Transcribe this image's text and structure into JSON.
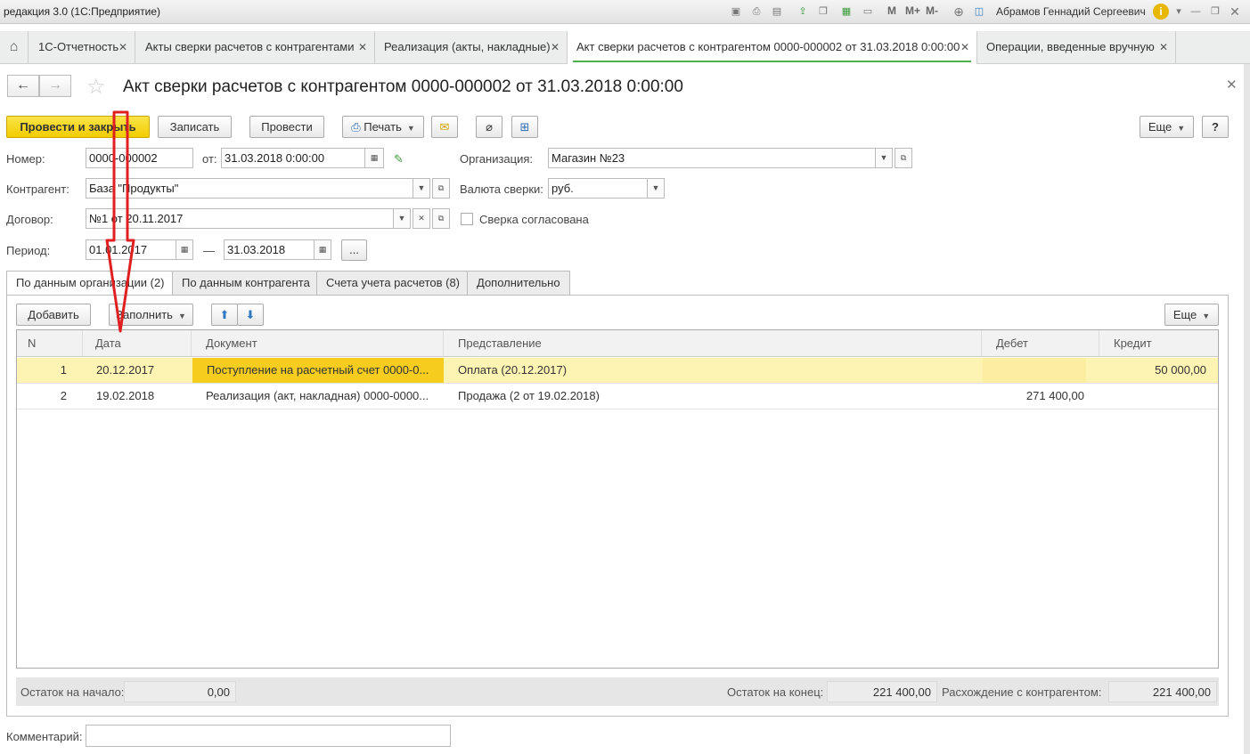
{
  "window": {
    "title": "редакция 3.0  (1С:Предприятие)",
    "user": "Абрамов Геннадий Сергеевич",
    "m_labels": [
      "M",
      "M+",
      "M-"
    ]
  },
  "open_tabs": [
    {
      "label": "1С-Отчетность"
    },
    {
      "label": "Акты сверки расчетов с контрагентами"
    },
    {
      "label": "Реализация (акты, накладные)"
    },
    {
      "label": "Акт сверки расчетов с контрагентом 0000-000002 от 31.03.2018 0:00:00"
    },
    {
      "label": "Операции, введенные вручную"
    }
  ],
  "form": {
    "title": "Акт сверки расчетов с контрагентом 0000-000002 от 31.03.2018 0:00:00",
    "toolbar": {
      "post_close": "Провести и закрыть",
      "save": "Записать",
      "post": "Провести",
      "print": "Печать",
      "more": "Еще",
      "help": "?"
    },
    "fields": {
      "number_label": "Номер:",
      "number": "0000-000002",
      "date_label": "от:",
      "date": "31.03.2018  0:00:00",
      "org_label": "Организация:",
      "org": "Магазин №23",
      "counterparty_label": "Контрагент:",
      "counterparty": "База \"Продукты\"",
      "currency_label": "Валюта сверки:",
      "currency": "руб.",
      "contract_label": "Договор:",
      "contract": "№1 от 20.11.2017",
      "agreed_label": "Сверка согласована",
      "period_label": "Период:",
      "period_from": "01.01.2017",
      "period_dash": "—",
      "period_to": "31.03.2018",
      "period_more": "..."
    },
    "inner_tabs": [
      {
        "label": "По данным организации (2)"
      },
      {
        "label": "По данным контрагента"
      },
      {
        "label": "Счета учета расчетов (8)"
      },
      {
        "label": "Дополнительно"
      }
    ],
    "table_toolbar": {
      "add": "Добавить",
      "fill": "Заполнить",
      "more": "Еще"
    },
    "table": {
      "headers": [
        "N",
        "Дата",
        "Документ",
        "Представление",
        "Дебет",
        "Кредит"
      ],
      "rows": [
        {
          "n": "1",
          "date": "20.12.2017",
          "doc": "Поступление на расчетный счет 0000-0...",
          "repr": "Оплата (20.12.2017)",
          "debit": "",
          "credit": "50 000,00"
        },
        {
          "n": "2",
          "date": "19.02.2018",
          "doc": "Реализация (акт, накладная) 0000-0000...",
          "repr": "Продажа (2 от 19.02.2018)",
          "debit": "271 400,00",
          "credit": ""
        }
      ]
    },
    "totals": {
      "start_label": "Остаток на начало:",
      "start": "0,00",
      "end_label": "Остаток на конец:",
      "end": "221 400,00",
      "diff_label": "Расхождение с контрагентом:",
      "diff": "221 400,00"
    },
    "comment_label": "Комментарий:",
    "comment": ""
  },
  "colors": {
    "primary_button": "#f2cd00",
    "selected_row": "#fdf4b3",
    "annotation_arrow": "#e02020"
  }
}
